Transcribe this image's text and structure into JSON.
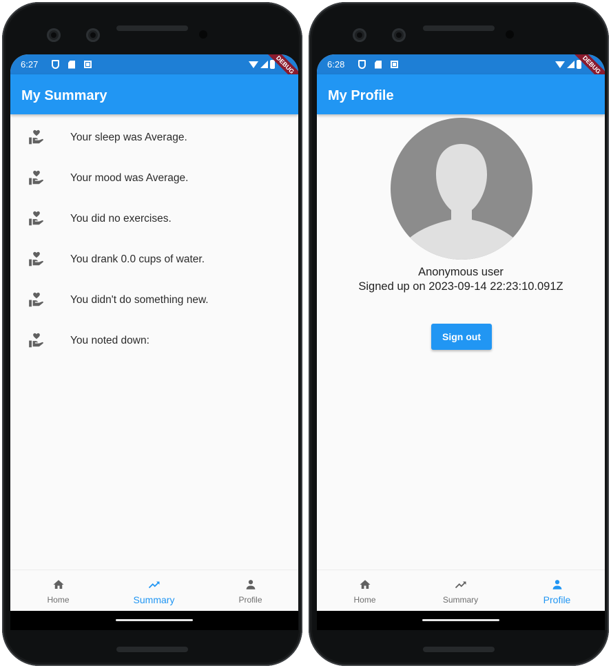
{
  "colors": {
    "primary": "#2196f3",
    "status_bar": "#1e7fd6",
    "debug_banner": "#8a1b2e",
    "inactive_icon": "#616161",
    "avatar_bg": "#8c8c8c"
  },
  "summary_screen": {
    "status_time": "6:27",
    "debug_label": "DEBUG",
    "title": "My Summary",
    "items": [
      {
        "icon": "volunteer-activism-icon",
        "text": "Your sleep was Average."
      },
      {
        "icon": "volunteer-activism-icon",
        "text": "Your mood was Average."
      },
      {
        "icon": "volunteer-activism-icon",
        "text": "You did no exercises."
      },
      {
        "icon": "volunteer-activism-icon",
        "text": "You drank 0.0 cups of water."
      },
      {
        "icon": "volunteer-activism-icon",
        "text": "You didn't do something new."
      },
      {
        "icon": "volunteer-activism-icon",
        "text": "You noted down:"
      }
    ],
    "nav": [
      {
        "label": "Home",
        "icon": "home-icon"
      },
      {
        "label": "Summary",
        "icon": "trending-up-icon"
      },
      {
        "label": "Profile",
        "icon": "person-icon"
      }
    ],
    "active_nav": "Summary"
  },
  "profile_screen": {
    "status_time": "6:28",
    "debug_label": "DEBUG",
    "title": "My Profile",
    "user_name": "Anonymous user",
    "signed_up": "Signed up on 2023-09-14 22:23:10.091Z",
    "sign_out_label": "Sign out",
    "nav": [
      {
        "label": "Home",
        "icon": "home-icon"
      },
      {
        "label": "Summary",
        "icon": "trending-up-icon"
      },
      {
        "label": "Profile",
        "icon": "person-icon"
      }
    ],
    "active_nav": "Profile"
  }
}
